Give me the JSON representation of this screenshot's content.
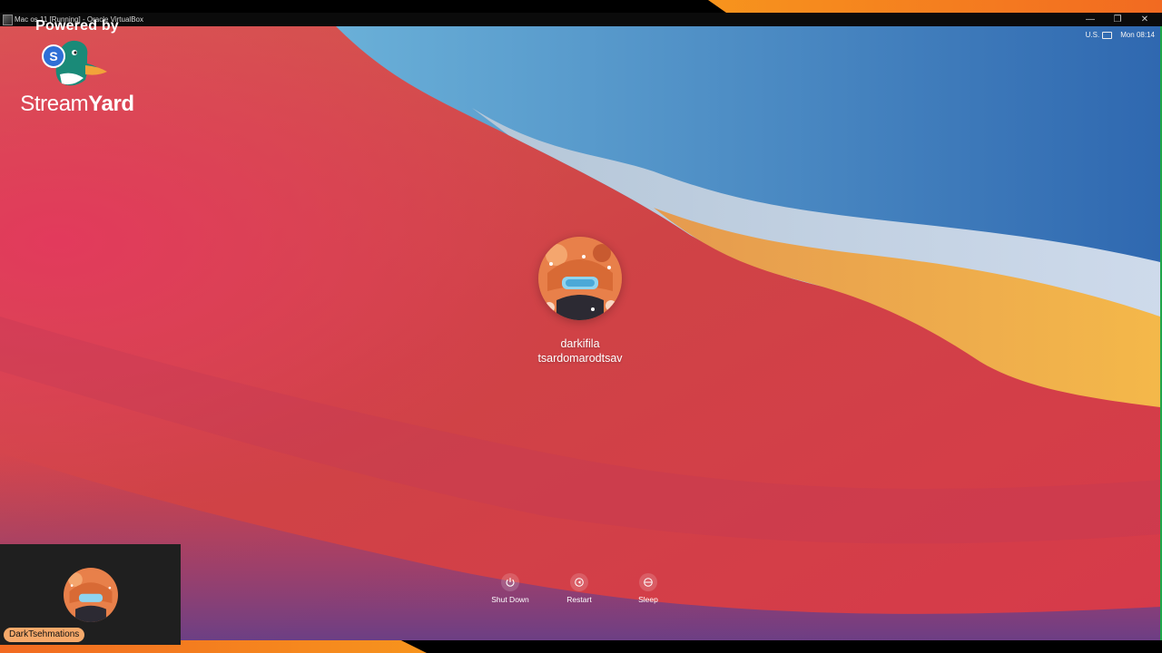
{
  "window": {
    "title": "Mac os 11 [Running] - Oracle VirtualBox",
    "minimize_glyph": "—",
    "maximize_glyph": "❐",
    "close_glyph": "✕"
  },
  "menu_status": {
    "keyboard": "U.S.",
    "clock": "Mon 08:14"
  },
  "login": {
    "user_line1": "darkifila",
    "user_line2": "tsardomarodtsav"
  },
  "power_buttons": [
    {
      "label": "Shut Down",
      "icon": "power-icon"
    },
    {
      "label": "Restart",
      "icon": "restart-icon"
    },
    {
      "label": "Sleep",
      "icon": "sleep-icon"
    }
  ],
  "streamyard": {
    "powered_by": "Powered by",
    "wordmark_light": "Stream",
    "wordmark_bold": "Yard",
    "badge_letter": "S"
  },
  "camera": {
    "name": "DarkTsehmations"
  },
  "colors": {
    "frame_orange": "#f7941d",
    "wallpaper_red": "#d84a46",
    "wallpaper_blue": "#3d7fc0",
    "wallpaper_yellow": "#f0b24a",
    "name_badge": "#f6a96a"
  }
}
